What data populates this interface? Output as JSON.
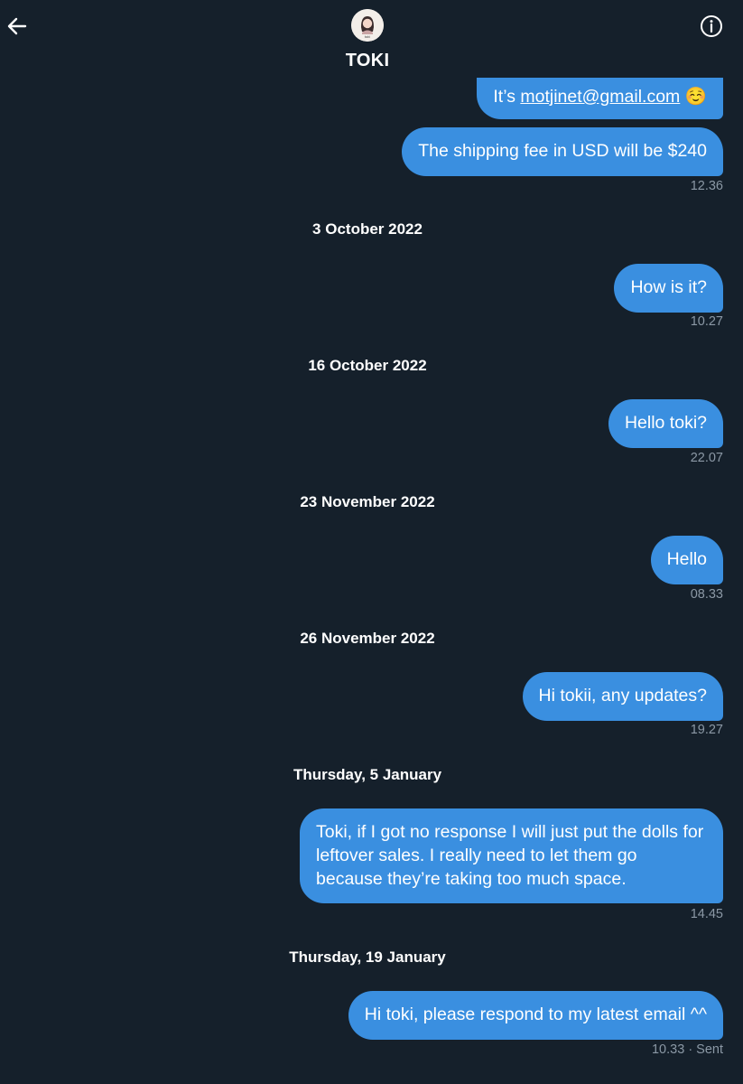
{
  "header": {
    "back_icon": "arrow-left-icon",
    "info_icon": "info-circle-icon",
    "avatar_label": "toki",
    "name": "TOKI"
  },
  "thread": {
    "msg1_prefix": "It’s ",
    "msg1_email": "motjinet@gmail.com",
    "msg1_emoji": "☺️",
    "msg2": "The shipping fee in USD will be $240",
    "time2": "12.36",
    "date1": "3 October 2022",
    "msg3": "How is it?",
    "time3": "10.27",
    "date2": "16 October 2022",
    "msg4": "Hello toki?",
    "time4": "22.07",
    "date3": "23 November 2022",
    "msg5": "Hello",
    "time5": "08.33",
    "date4": "26 November 2022",
    "msg6": "Hi tokii, any updates?",
    "time6": "19.27",
    "date5": "Thursday, 5 January",
    "msg7": "Toki, if I got no response I will just put the dolls for leftover sales. I really need to let them go because they’re taking too much space.",
    "time7": "14.45",
    "date6": "Thursday, 19 January",
    "msg8": "Hi toki, please respond to my latest email ^^",
    "time8": "10.33",
    "status8": "· Sent"
  },
  "colors": {
    "background": "#15202b",
    "bubble": "#3a8fe0",
    "timestamp": "#8b98a5"
  }
}
